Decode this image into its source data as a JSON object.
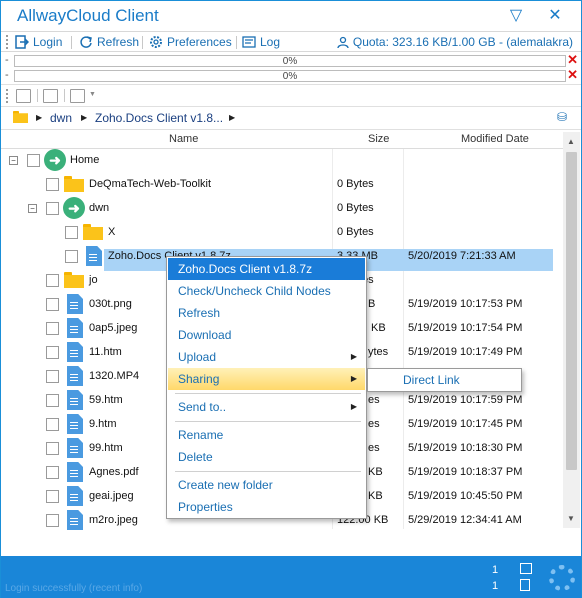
{
  "window": {
    "title": "AllwayCloud Client",
    "minimize_glyph": "▽",
    "close_glyph": "✕"
  },
  "toolbar": {
    "login": "Login",
    "refresh": "Refresh",
    "preferences": "Preferences",
    "log": "Log",
    "quota": "Quota: 323.16 KB/1.00 GB - (alemalakra)"
  },
  "transfers": [
    {
      "dash": "-",
      "percent": "0%"
    },
    {
      "dash": "-",
      "percent": "0%"
    }
  ],
  "breadcrumb": {
    "items": [
      "dwn",
      "Zoho.Docs Client v1.8..."
    ]
  },
  "columns": {
    "name": "Name",
    "size": "Size",
    "modified": "Modified Date"
  },
  "tree": [
    {
      "name": "Home",
      "size": "",
      "date": ""
    },
    {
      "name": "DeQmaTech-Web-Toolkit",
      "size": "0 Bytes",
      "date": ""
    },
    {
      "name": "dwn",
      "size": "0 Bytes",
      "date": ""
    },
    {
      "name": "X",
      "size": "0 Bytes",
      "date": ""
    },
    {
      "name": "Zoho.Docs Client v1.8.7z",
      "size": "3.33 MB",
      "date": "5/20/2019 7:21:33 AM"
    },
    {
      "name": "jo",
      "size": "0 Bytes",
      "date": ""
    },
    {
      "name": "030t.png",
      "size": "B",
      "date": "5/19/2019 10:17:53 PM"
    },
    {
      "name": "0ap5.jpeg",
      "size": "KB",
      "date": "5/19/2019 10:17:54 PM"
    },
    {
      "name": "11.htm",
      "size": "ytes",
      "date": "5/19/2019 10:17:49 PM"
    },
    {
      "name": "1320.MP4",
      "size": "",
      "date": ""
    },
    {
      "name": "59.htm",
      "size": "es",
      "date": "5/19/2019 10:17:59 PM"
    },
    {
      "name": "9.htm",
      "size": "es",
      "date": "5/19/2019 10:17:45 PM"
    },
    {
      "name": "99.htm",
      "size": "es",
      "date": "5/19/2019 10:18:30 PM"
    },
    {
      "name": "Agnes.pdf",
      "size": "KB",
      "date": "5/19/2019 10:18:37 PM"
    },
    {
      "name": "geai.jpeg",
      "size": "KB",
      "date": "5/19/2019 10:45:50 PM"
    },
    {
      "name": "m2ro.jpeg",
      "size": "122.00 KB",
      "date": "5/29/2019 12:34:41 AM"
    }
  ],
  "context_menu": {
    "title": "Zoho.Docs Client v1.8.7z",
    "check_uncheck": "Check/Uncheck Child Nodes",
    "refresh": "Refresh",
    "download": "Download",
    "upload": "Upload",
    "sharing": "Sharing",
    "send_to": "Send to..",
    "rename": "Rename",
    "delete": "Delete",
    "create_folder": "Create new folder",
    "properties": "Properties",
    "submenu_direct_link": "Direct Link"
  },
  "status": {
    "folders_count": "1",
    "files_count": "1",
    "faint_text": "Login successfully (recent info)"
  }
}
